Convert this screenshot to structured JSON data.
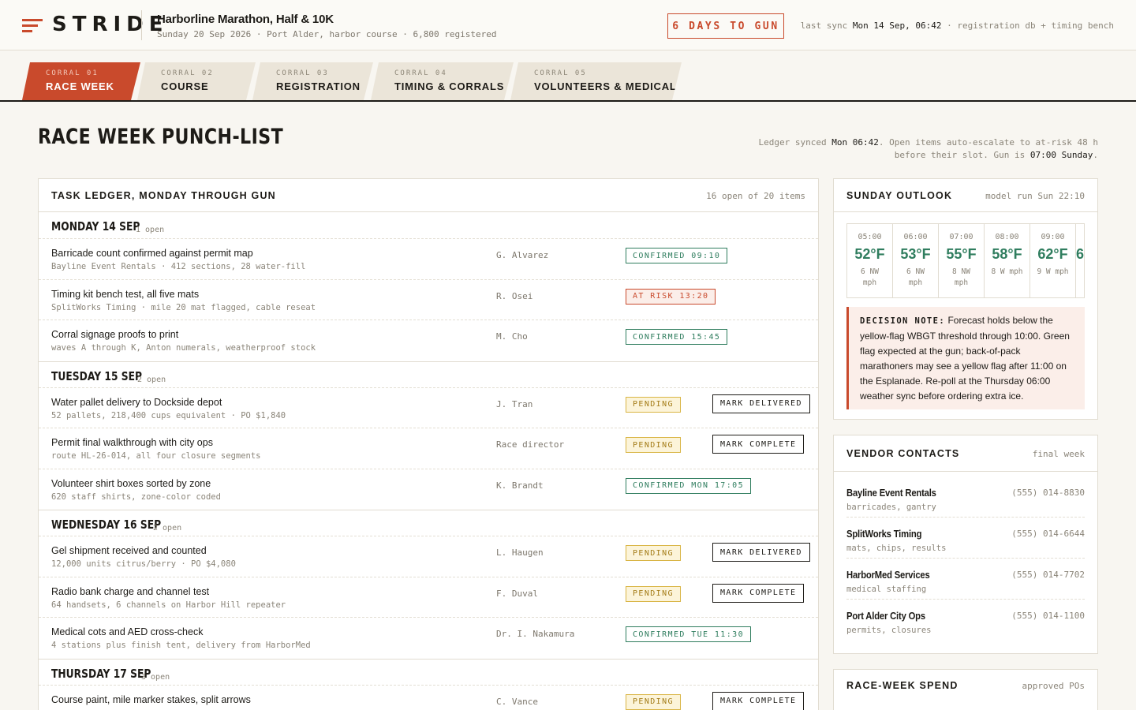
{
  "brand": {
    "name": "STRIDE",
    "accent": "#c94a2c"
  },
  "event": {
    "title": "Harborline Marathon, Half & 10K",
    "subtitle": "Sunday 20 Sep 2026 · Port Alder, harbor course · 6,800 registered"
  },
  "countdown": "6 DAYS TO GUN",
  "sync": {
    "prefix": "last sync",
    "time": "Mon 14 Sep, 06:42",
    "suffix": "· registration db + timing bench"
  },
  "tabs": [
    {
      "key": "CORRAL 01",
      "label": "RACE WEEK",
      "active": true
    },
    {
      "key": "CORRAL 02",
      "label": "COURSE"
    },
    {
      "key": "CORRAL 03",
      "label": "REGISTRATION"
    },
    {
      "key": "CORRAL 04",
      "label": "TIMING & CORRALS"
    },
    {
      "key": "CORRAL 05",
      "label": "VOLUNTEERS & MEDICAL"
    }
  ],
  "page": {
    "title": "RACE WEEK PUNCH-LIST",
    "note_a": "Ledger synced ",
    "note_time": "Mon 06:42",
    "note_b": ". Open items auto-escalate to at-risk 48 h before their slot. Gun is ",
    "note_gun": "07:00 Sunday",
    "note_c": "."
  },
  "ledger": {
    "title": "TASK LEDGER, MONDAY THROUGH GUN",
    "meta": "16 open of 20 items",
    "days": [
      {
        "title": "MONDAY 14 SEP",
        "count": "1 open",
        "tasks": [
          {
            "name": "Barricade count confirmed against permit map",
            "sub": "Bayline Event Rentals · 412 sections, 28 water-fill",
            "owner": "G. Alvarez",
            "status": "CONFIRMED 09:10",
            "kind": "confirmed"
          },
          {
            "name": "Timing kit bench test, all five mats",
            "sub": "SplitWorks Timing · mile 20 mat flagged, cable reseat",
            "owner": "R. Osei",
            "status": "AT RISK 13:20",
            "kind": "risk"
          },
          {
            "name": "Corral signage proofs to print",
            "sub": "waves A through K, Anton numerals, weatherproof stock",
            "owner": "M. Cho",
            "status": "CONFIRMED 15:45",
            "kind": "confirmed"
          }
        ]
      },
      {
        "title": "TUESDAY 15 SEP",
        "count": "2 open",
        "tasks": [
          {
            "name": "Water pallet delivery to Dockside depot",
            "sub": "52 pallets, 218,400 cups equivalent · PO $1,840",
            "owner": "J. Tran",
            "status": "PENDING",
            "kind": "pending",
            "action": "MARK DELIVERED"
          },
          {
            "name": "Permit final walkthrough with city ops",
            "sub": "route HL-26-014, all four closure segments",
            "owner": "Race director",
            "status": "PENDING",
            "kind": "pending",
            "action": "MARK COMPLETE"
          },
          {
            "name": "Volunteer shirt boxes sorted by zone",
            "sub": "620 staff shirts, zone-color coded",
            "owner": "K. Brandt",
            "status": "CONFIRMED MON 17:05",
            "kind": "confirmed"
          }
        ]
      },
      {
        "title": "WEDNESDAY 16 SEP",
        "count": "2 open",
        "tasks": [
          {
            "name": "Gel shipment received and counted",
            "sub": "12,000 units citrus/berry · PO $4,080",
            "owner": "L. Haugen",
            "status": "PENDING",
            "kind": "pending",
            "action": "MARK DELIVERED"
          },
          {
            "name": "Radio bank charge and channel test",
            "sub": "64 handsets, 6 channels on Harbor Hill repeater",
            "owner": "F. Duval",
            "status": "PENDING",
            "kind": "pending",
            "action": "MARK COMPLETE"
          },
          {
            "name": "Medical cots and AED cross-check",
            "sub": "4 stations plus finish tent, delivery from HarborMed",
            "owner": "Dr. I. Nakamura",
            "status": "CONFIRMED TUE 11:30",
            "kind": "confirmed"
          }
        ]
      },
      {
        "title": "THURSDAY 17 SEP",
        "count": "3 open",
        "tasks": [
          {
            "name": "Course paint, mile marker stakes, split arrows",
            "sub": "",
            "owner": "C. Vance",
            "status": "PENDING",
            "kind": "pending",
            "action": "MARK COMPLETE"
          }
        ]
      }
    ]
  },
  "outlook": {
    "title": "SUNDAY OUTLOOK",
    "meta": "model run Sun 22:10",
    "hours": [
      {
        "time": "05:00",
        "temp": "52°F",
        "wind": "6 NW mph"
      },
      {
        "time": "06:00",
        "temp": "53°F",
        "wind": "6 NW mph"
      },
      {
        "time": "07:00",
        "temp": "55°F",
        "wind": "8 NW mph"
      },
      {
        "time": "08:00",
        "temp": "58°F",
        "wind": "8 W mph"
      },
      {
        "time": "09:00",
        "temp": "62°F",
        "wind": "9 W mph"
      },
      {
        "time": "10:00",
        "temp": "6",
        "wind": ""
      }
    ],
    "note_key": "DECISION NOTE:",
    "note_text": "Forecast holds below the yellow-flag WBGT threshold through 10:00. Green flag expected at the gun; back-of-pack marathoners may see a yellow flag after 11:00 on the Esplanade. Re-poll at the Thursday 06:00 weather sync before ordering extra ice."
  },
  "vendors": {
    "title": "VENDOR CONTACTS",
    "meta": "final week",
    "items": [
      {
        "name": "Bayline Event Rentals",
        "role": "barricades, gantry",
        "phone": "(555) 014-8830"
      },
      {
        "name": "SplitWorks Timing",
        "role": "mats, chips, results",
        "phone": "(555) 014-6644"
      },
      {
        "name": "HarborMed Services",
        "role": "medical staffing",
        "phone": "(555) 014-7702"
      },
      {
        "name": "Port Alder City Ops",
        "role": "permits, closures",
        "phone": "(555) 014-1100"
      }
    ]
  },
  "spend": {
    "title": "RACE-WEEK SPEND",
    "meta": "approved POs"
  }
}
